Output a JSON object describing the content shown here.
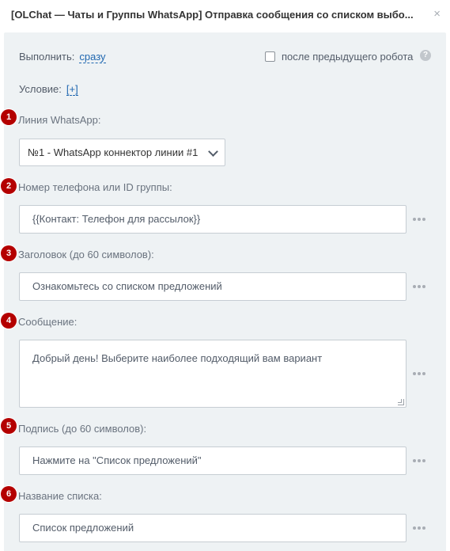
{
  "header": {
    "title": "[OLChat — Чаты и Группы WhatsApp] Отправка сообщения со списком выбо...",
    "close_glyph": "×"
  },
  "execute": {
    "label": "Выполнить:",
    "value": "сразу"
  },
  "after_robot": {
    "label": "после предыдущего робота",
    "checked": false,
    "help_glyph": "?"
  },
  "condition": {
    "label": "Условие:",
    "add": "[+]"
  },
  "fields": [
    {
      "marker": "1",
      "label": "Линия WhatsApp:",
      "value": "№1 - WhatsApp коннектор линии #1"
    },
    {
      "marker": "2",
      "label": "Номер телефона или ID группы:",
      "value": "{{Контакт: Телефон для рассылок}}"
    },
    {
      "marker": "3",
      "label": "Заголовок (до 60 символов):",
      "value": "Ознакомьтесь со списком предложений"
    },
    {
      "marker": "4",
      "label": "Сообщение:",
      "value": "Добрый день! Выберите наиболее подходящий вам вариант"
    },
    {
      "marker": "5",
      "label": "Подпись (до 60 символов):",
      "value": "Нажмите на \"Список предложений\""
    },
    {
      "marker": "6",
      "label": "Название списка:",
      "value": "Список предложений"
    }
  ],
  "colors": {
    "marker": "#b40000",
    "link": "#2067b0",
    "panel": "#eef2f4"
  }
}
